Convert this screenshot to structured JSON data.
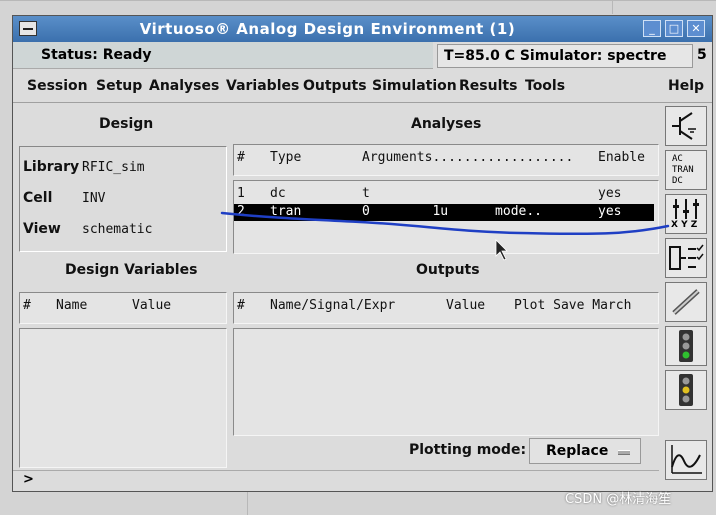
{
  "window": {
    "title": "Virtuoso® Analog Design Environment (1)"
  },
  "status": {
    "left": "Status: Ready",
    "right": "T=85.0 C  Simulator: spectre",
    "number": "5"
  },
  "menu": {
    "items": [
      "Session",
      "Setup",
      "Analyses",
      "Variables",
      "Outputs",
      "Simulation",
      "Results",
      "Tools"
    ],
    "help": "Help"
  },
  "design": {
    "title": "Design",
    "library_label": "Library",
    "library_value": "RFIC_sim",
    "cell_label": "Cell",
    "cell_value": "INV",
    "view_label": "View",
    "view_value": "schematic"
  },
  "analyses": {
    "title": "Analyses",
    "headers": {
      "num": "#",
      "type": "Type",
      "arguments": "Arguments..................",
      "enable": "Enable"
    },
    "rows": [
      {
        "num": "1",
        "type": "dc",
        "args": "t",
        "enable": "yes"
      },
      {
        "num": "2",
        "type": "tran",
        "args": "0        1u      mode..",
        "enable": "yes"
      }
    ]
  },
  "design_variables": {
    "title": "Design Variables",
    "headers": {
      "num": "#",
      "name": "Name",
      "value": "Value"
    }
  },
  "outputs": {
    "title": "Outputs",
    "headers": {
      "num": "#",
      "name": "Name/Signal/Expr",
      "value": "Value",
      "rest": "Plot Save March"
    },
    "plotting_mode_label": "Plotting mode:",
    "plotting_mode_value": "Replace"
  },
  "prompt": ">",
  "toolbar": {
    "icons": [
      "transistor-icon",
      "ac-tran-dc-icon",
      "xyz-sliders-icon",
      "checklist-icon",
      "pen-icon",
      "traffic-light-run-icon",
      "traffic-light-stop-icon",
      "waveform-icon"
    ],
    "ac_tran_dc_text": [
      "AC",
      "TRAN",
      "DC"
    ],
    "xyz_text": "X Y Z"
  },
  "annotation_color": "#1f3fc4",
  "watermark": "CSDN @林清海笙"
}
